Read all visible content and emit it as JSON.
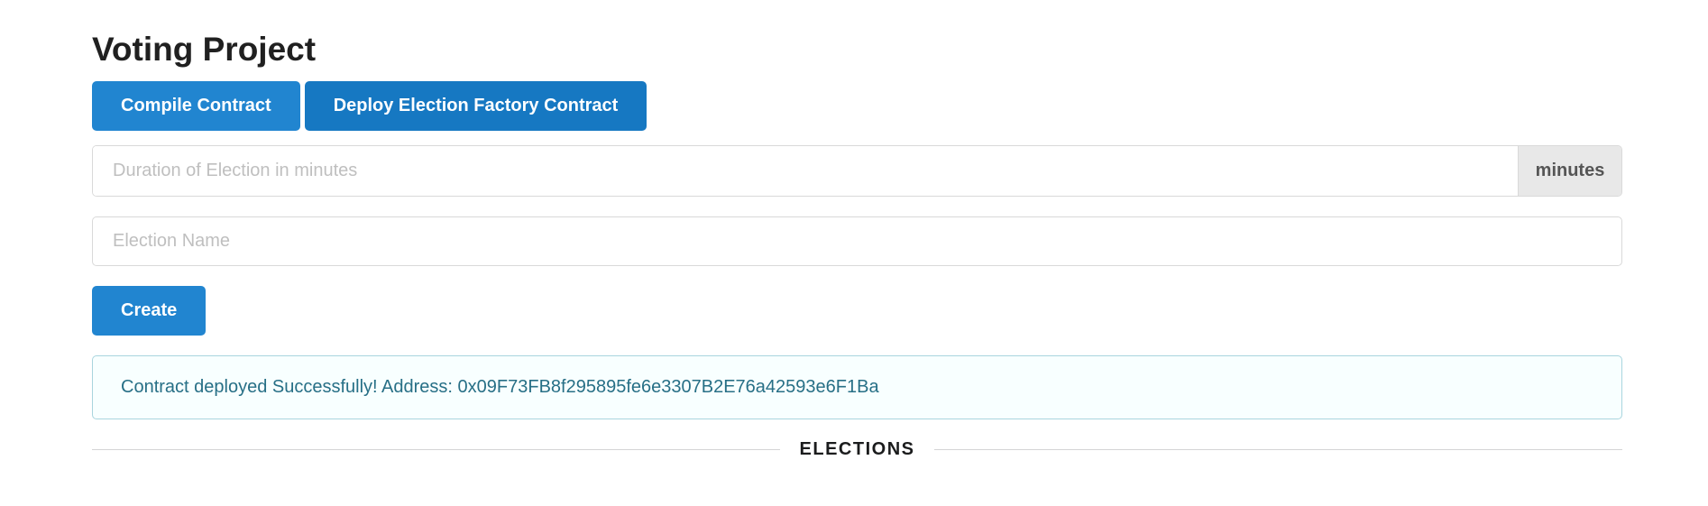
{
  "header": {
    "title": "Voting Project"
  },
  "toolbar": {
    "compile_label": "Compile Contract",
    "deploy_label": "Deploy Election Factory Contract"
  },
  "form": {
    "duration": {
      "placeholder": "Duration of Election in minutes",
      "value": "",
      "unit_label": "minutes"
    },
    "name": {
      "placeholder": "Election Name",
      "value": ""
    },
    "create_label": "Create"
  },
  "message": {
    "text": "Contract deployed Successfully! Address: 0x09F73FB8f295895fe6e3307B2E76a42593e6F1Ba"
  },
  "divider": {
    "label": "ELECTIONS"
  },
  "colors": {
    "primary": "#2185d0",
    "primary_dark": "#1678c2",
    "message_bg": "#f8ffff",
    "message_border": "#a9d5de",
    "message_text": "#276f86"
  }
}
